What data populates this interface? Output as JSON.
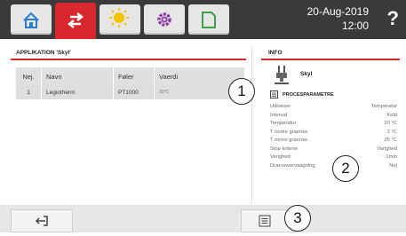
{
  "header": {
    "tabs": [
      {
        "name": "home-icon",
        "active": false
      },
      {
        "name": "sync-arrows-icon",
        "active": true
      },
      {
        "name": "sun-icon",
        "active": false
      },
      {
        "name": "gear-icon",
        "active": false
      },
      {
        "name": "document-icon",
        "active": false
      }
    ],
    "date": "20-Aug-2019",
    "time": "12:00",
    "help": "?"
  },
  "application": {
    "title": "APPLIKATION 'Skyl'",
    "columns": [
      "Nej.",
      "Navn",
      "Føler",
      "Vaerdi"
    ],
    "rows": [
      {
        "nr": "1",
        "name": "Legiotherm",
        "sensor": "PT1000",
        "value": "20°C"
      }
    ]
  },
  "info": {
    "title": "INFO",
    "app_name": "Skyl",
    "section_title": "PROCESPARAMETRE",
    "params": [
      {
        "name": "Udloeser",
        "value": "Temperatur"
      },
      {
        "name": "Interval",
        "value": "Kold"
      },
      {
        "name": "Temperatur",
        "value": "20 °C"
      },
      {
        "name": "T nedre graense",
        "value": "2 °C"
      },
      {
        "name": "T oevre graense",
        "value": "25 °C"
      },
      {
        "name": "Stop kriterie",
        "value": "Varighed"
      },
      {
        "name": "Varighed",
        "value": "1min"
      },
      {
        "name": "Draenovervaagning",
        "value": "Nej"
      }
    ]
  },
  "callouts": [
    "1",
    "2",
    "3"
  ],
  "colors": {
    "accent": "#d7262c",
    "topbar": "#3a3a3a"
  }
}
